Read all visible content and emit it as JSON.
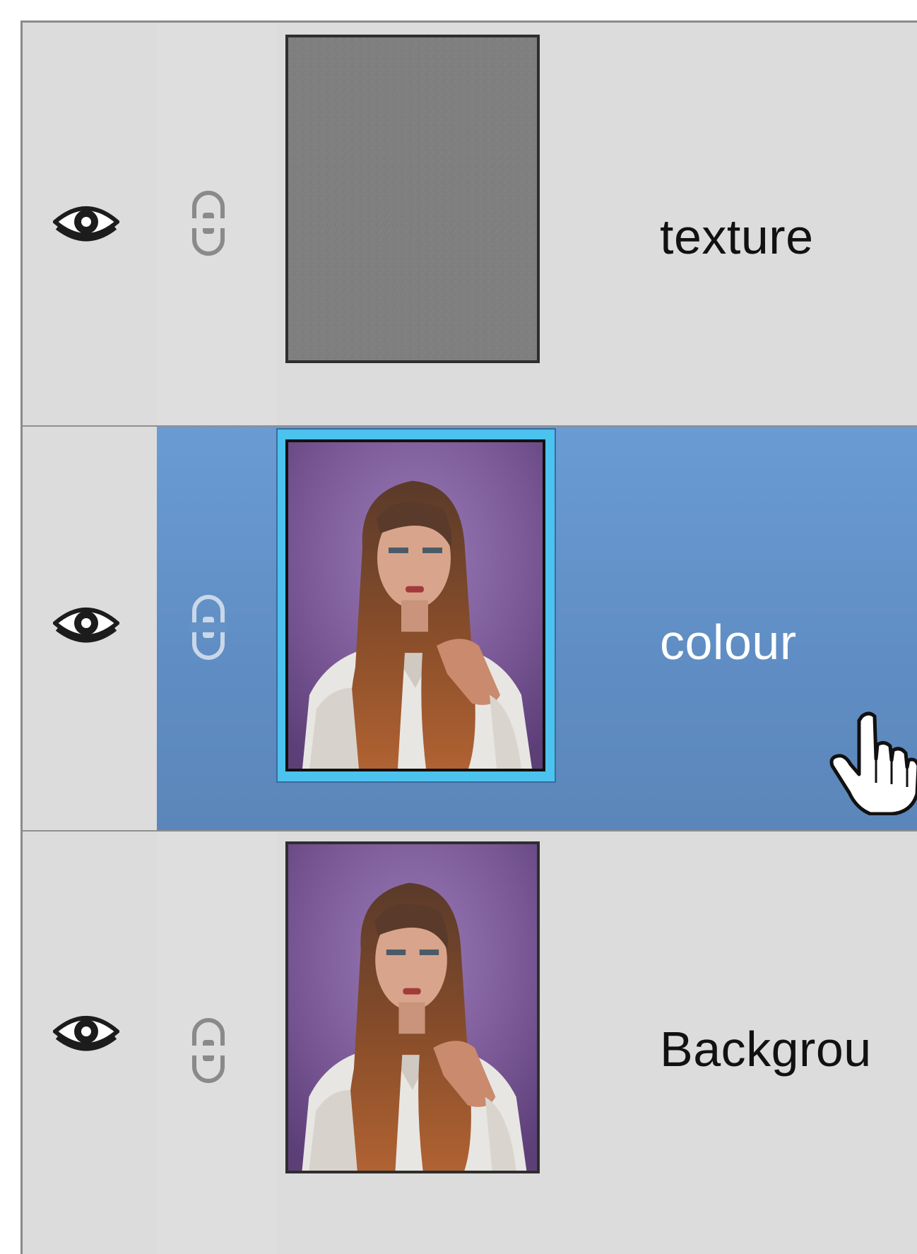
{
  "layers_panel": {
    "layers": [
      {
        "name": "texture",
        "visible": true,
        "selected": false,
        "thumbnail": "gray-noise-texture"
      },
      {
        "name": "colour",
        "visible": true,
        "selected": true,
        "thumbnail": "portrait-woman-purple-background"
      },
      {
        "name": "Backgrou",
        "visible": true,
        "selected": false,
        "thumbnail": "portrait-woman-purple-background"
      }
    ],
    "icons": {
      "visibility": "eye-icon",
      "link": "chain-link-icon",
      "cursor": "hand-pointer-cursor"
    },
    "colors": {
      "panel_bg": "#dcdcdd",
      "selected_row": "#6a9bd3",
      "selected_thumb_ring": "#4cc2ee",
      "purple_backdrop": "#7d5a99"
    }
  }
}
